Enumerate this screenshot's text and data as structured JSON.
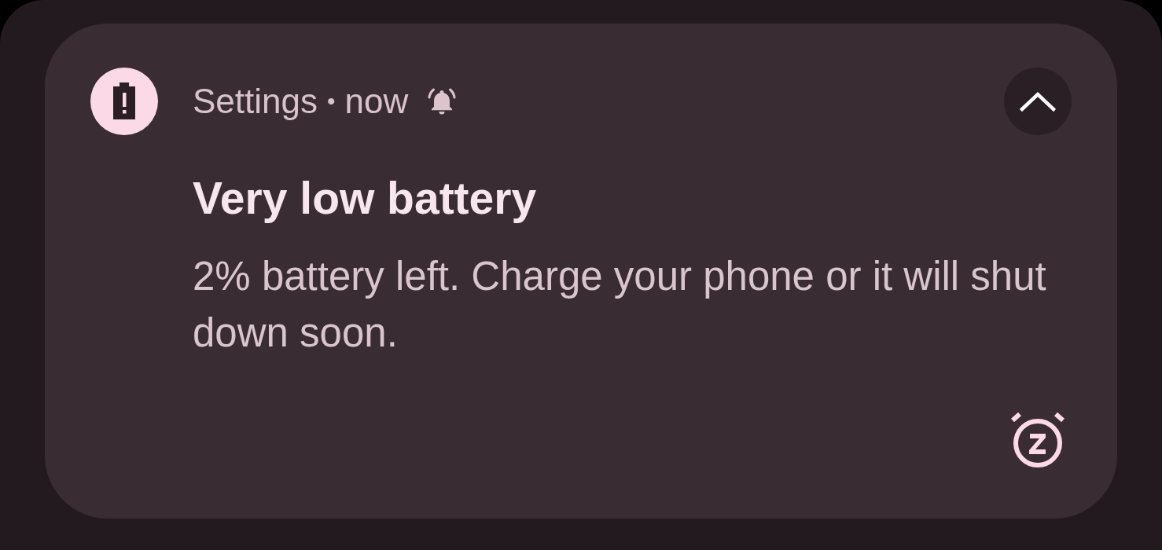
{
  "notification": {
    "app_name": "Settings",
    "separator": "•",
    "time": "now",
    "alerted": true,
    "expanded": true,
    "title": "Very low battery",
    "body": "2% battery left. Charge your phone or it will shut down soon."
  }
}
